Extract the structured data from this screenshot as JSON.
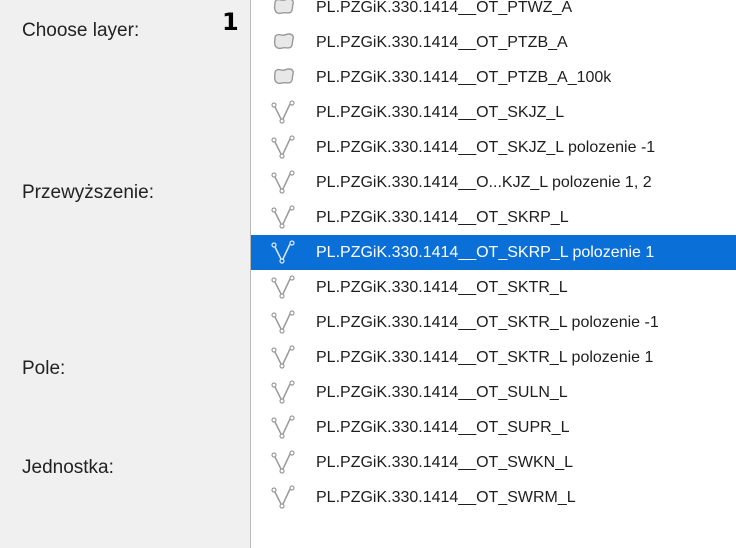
{
  "callout_number": "1",
  "form": {
    "choose_layer_label": "Choose layer:",
    "przewyzszenie_label": "Przewyższenie:",
    "pole_label": "Pole:",
    "jednostka_label": "Jednostka:"
  },
  "colors": {
    "selection_bg": "#0a6fd6",
    "icon_stroke": "#9a9a9a"
  },
  "layers": [
    {
      "name": "PL.PZGiK.330.1414__OT_PTWZ_A",
      "icon": "polygon-layer-icon",
      "selected": false
    },
    {
      "name": "PL.PZGiK.330.1414__OT_PTZB_A",
      "icon": "polygon-layer-icon",
      "selected": false
    },
    {
      "name": "PL.PZGiK.330.1414__OT_PTZB_A_100k",
      "icon": "polygon-layer-icon",
      "selected": false
    },
    {
      "name": "PL.PZGiK.330.1414__OT_SKJZ_L",
      "icon": "line-layer-icon",
      "selected": false
    },
    {
      "name": "PL.PZGiK.330.1414__OT_SKJZ_L polozenie -1",
      "icon": "line-layer-icon",
      "selected": false
    },
    {
      "name": "PL.PZGiK.330.1414__O...KJZ_L polozenie 1, 2",
      "icon": "line-layer-icon",
      "selected": false
    },
    {
      "name": "PL.PZGiK.330.1414__OT_SKRP_L",
      "icon": "line-layer-icon",
      "selected": false
    },
    {
      "name": "PL.PZGiK.330.1414__OT_SKRP_L polozenie 1",
      "icon": "line-layer-icon",
      "selected": true
    },
    {
      "name": "PL.PZGiK.330.1414__OT_SKTR_L",
      "icon": "line-layer-icon",
      "selected": false
    },
    {
      "name": "PL.PZGiK.330.1414__OT_SKTR_L polozenie -1",
      "icon": "line-layer-icon",
      "selected": false
    },
    {
      "name": "PL.PZGiK.330.1414__OT_SKTR_L polozenie 1",
      "icon": "line-layer-icon",
      "selected": false
    },
    {
      "name": "PL.PZGiK.330.1414__OT_SULN_L",
      "icon": "line-layer-icon",
      "selected": false
    },
    {
      "name": "PL.PZGiK.330.1414__OT_SUPR_L",
      "icon": "line-layer-icon",
      "selected": false
    },
    {
      "name": "PL.PZGiK.330.1414__OT_SWKN_L",
      "icon": "line-layer-icon",
      "selected": false
    },
    {
      "name": "PL.PZGiK.330.1414__OT_SWRM_L",
      "icon": "line-layer-icon",
      "selected": false
    }
  ]
}
